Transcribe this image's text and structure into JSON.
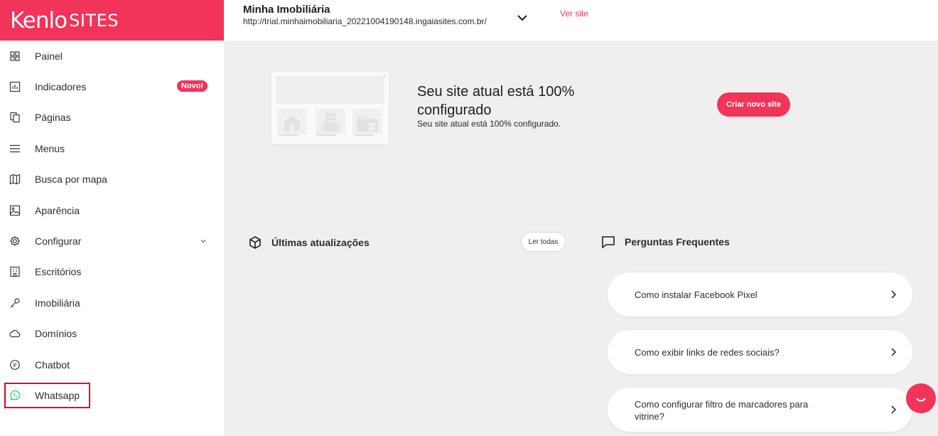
{
  "brand": {
    "logo_main": "Kenlo",
    "logo_sub": "SITES"
  },
  "sidebar": {
    "items": [
      {
        "label": "Painel",
        "icon": "grid-icon"
      },
      {
        "label": "Indicadores",
        "icon": "chart-icon",
        "badge": "Novo!"
      },
      {
        "label": "Páginas",
        "icon": "pages-icon"
      },
      {
        "label": "Menus",
        "icon": "menu-icon"
      },
      {
        "label": "Busca por mapa",
        "icon": "map-icon"
      },
      {
        "label": "Aparência",
        "icon": "image-icon"
      },
      {
        "label": "Configurar",
        "icon": "gear-icon"
      },
      {
        "label": "Escritórios",
        "icon": "building-icon"
      },
      {
        "label": "Imobiliária",
        "icon": "key-icon"
      },
      {
        "label": "Domínios",
        "icon": "cloud-icon"
      },
      {
        "label": "Chatbot",
        "icon": "chat-bubble-icon"
      },
      {
        "label": "Whatsapp",
        "icon": "whatsapp-icon"
      }
    ]
  },
  "header": {
    "site_name": "Minha Imobiliária",
    "site_url": "http://trial.minhaimobiliaria_20221004190148.ingaiasites.com.br/",
    "view_site": "Ver site"
  },
  "hero": {
    "title": "Seu site atual está 100% configurado",
    "subtitle": "Seu site atual está 100% configurado.",
    "create_button": "Criar novo site"
  },
  "updates": {
    "title": "Últimas atualizações",
    "read_all": "Ler todas"
  },
  "faq": {
    "title": "Perguntas Frequentes",
    "items": [
      "Como instalar Facebook Pixel",
      "Como exibir links de redes sociais?",
      "Como configurar filtro de marcadores para vitrine?"
    ]
  },
  "colors": {
    "accent": "#f2335a",
    "highlight_border": "#e0001b"
  }
}
